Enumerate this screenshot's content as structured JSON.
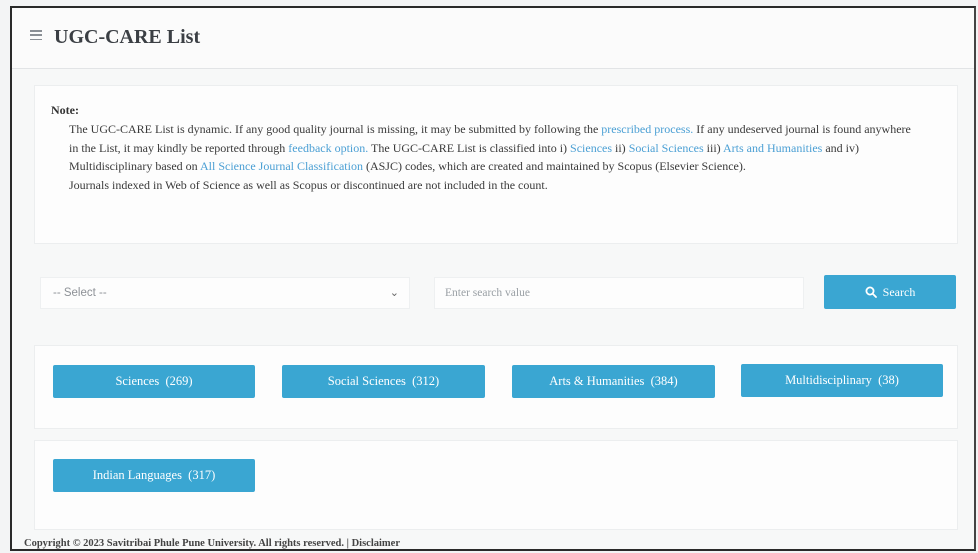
{
  "header": {
    "menu_icon": "hamburger-icon",
    "title": "UGC-CARE List"
  },
  "note": {
    "label": "Note:",
    "p1": {
      "t1": "The UGC-CARE List is dynamic. If any good quality journal is missing, it may be submitted by following the ",
      "link1": "prescribed process.",
      "t2": " If any undeserved journal is found anywhere in the List, it may kindly be reported through ",
      "link2": "feedback option.",
      "t3": " The UGC-CARE List is classified into i) ",
      "link3": "Sciences",
      "t4": " ii) ",
      "link4": "Social Sciences",
      "t5": " iii) ",
      "link5": "Arts and Humanities",
      "t6": " and iv) Multidisciplinary based on ",
      "link6": "All Science Journal Classification",
      "t7": " (ASJC) codes, which are created and maintained by Scopus (Elsevier Science)."
    },
    "p2": "Journals indexed in Web of Science as well as Scopus or discontinued are not included in the count."
  },
  "search": {
    "select_value": "-- Select --",
    "input_placeholder": "Enter search value",
    "input_value": "",
    "button_label": "Search",
    "button_icon": "search-icon"
  },
  "categories": [
    {
      "label": "Sciences  (269)"
    },
    {
      "label": "Social Sciences  (312)"
    },
    {
      "label": "Arts & Humanities  (384)"
    },
    {
      "label": "Multidisciplinary  (38)"
    },
    {
      "label": "Indian Languages  (317)"
    }
  ],
  "footer": {
    "text": "Copyright © 2023 Savitribai Phule Pune University. All rights reserved. | Disclaimer"
  },
  "colors": {
    "accent": "#3aa6d2",
    "link": "#4a9fd4"
  }
}
